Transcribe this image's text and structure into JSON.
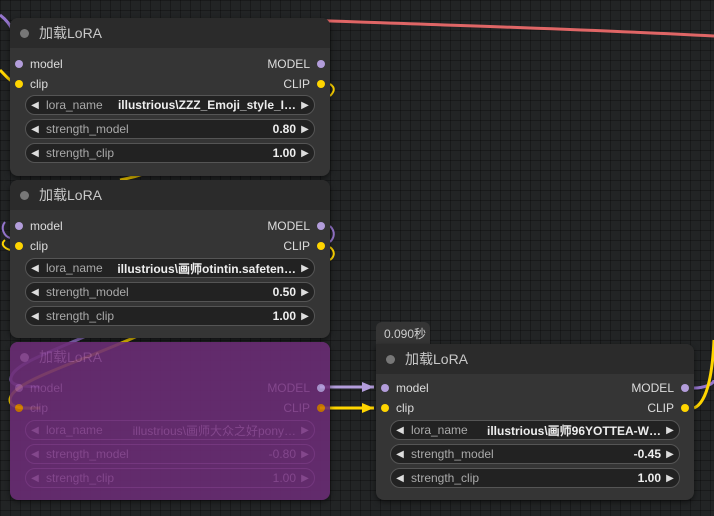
{
  "nodes": [
    {
      "title": "加载LoRA",
      "bypassed": false,
      "inputs": [
        "model",
        "clip"
      ],
      "outputs": [
        "MODEL",
        "CLIP"
      ],
      "widgets": [
        {
          "name": "lora_name",
          "value": "illustrious\\ZZZ_Emoji_style_I…"
        },
        {
          "name": "strength_model",
          "value": "0.80"
        },
        {
          "name": "strength_clip",
          "value": "1.00"
        }
      ]
    },
    {
      "title": "加载LoRA",
      "bypassed": false,
      "inputs": [
        "model",
        "clip"
      ],
      "outputs": [
        "MODEL",
        "CLIP"
      ],
      "widgets": [
        {
          "name": "lora_name",
          "value": "illustrious\\画师otintin.safeten…"
        },
        {
          "name": "strength_model",
          "value": "0.50"
        },
        {
          "name": "strength_clip",
          "value": "1.00"
        }
      ]
    },
    {
      "title": "加载LoRA",
      "bypassed": true,
      "inputs": [
        "model",
        "clip"
      ],
      "outputs": [
        "MODEL",
        "CLIP"
      ],
      "widgets": [
        {
          "name": "lora_name",
          "value": "illustrious\\画师大众之好pony…"
        },
        {
          "name": "strength_model",
          "value": "-0.80"
        },
        {
          "name": "strength_clip",
          "value": "1.00"
        }
      ]
    },
    {
      "title": "加载LoRA",
      "bypassed": false,
      "badge": "0.090秒",
      "inputs": [
        "model",
        "clip"
      ],
      "outputs": [
        "MODEL",
        "CLIP"
      ],
      "widgets": [
        {
          "name": "lora_name",
          "value": "illustrious\\画师96YOTTEA-W…"
        },
        {
          "name": "strength_model",
          "value": "-0.45"
        },
        {
          "name": "strength_clip",
          "value": "1.00"
        }
      ]
    }
  ],
  "colors": {
    "model_link": "#b39ddb",
    "clip_link": "#ffd500",
    "red_link": "#e06666",
    "bypass": "#6a2c74"
  },
  "icons": {
    "left_arrow": "◀",
    "right_arrow": "▶"
  }
}
